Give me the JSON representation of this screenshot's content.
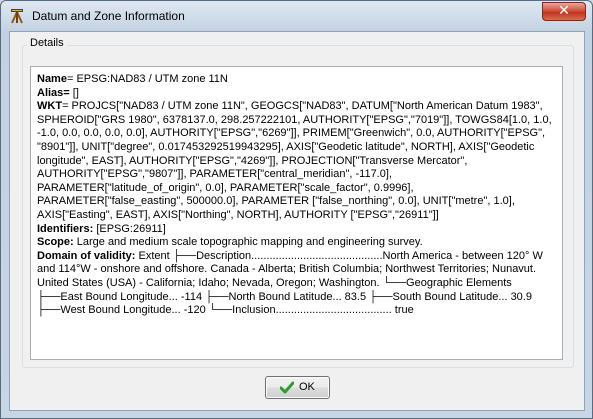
{
  "window": {
    "title": "Datum and Zone Information",
    "close_symbol": "✕",
    "close_icon": "close-icon",
    "app_icon": "tripod-icon"
  },
  "details": {
    "group_label": "Details",
    "name_label": "Name",
    "name_value": "EPSG:NAD83 / UTM zone 11N",
    "alias_label": "Alias",
    "alias_value": "[]",
    "wkt_label": "WKT",
    "wkt_value": "PROJCS[\"NAD83 / UTM zone 11N\", GEOGCS[\"NAD83\", DATUM[\"North American Datum 1983\", SPHEROID[\"GRS 1980\", 6378137.0, 298.257222101, AUTHORITY[\"EPSG\",\"7019\"]], TOWGS84[1.0, 1.0, -1.0, 0.0, 0.0, 0.0, 0.0], AUTHORITY[\"EPSG\",\"6269\"]], PRIMEM[\"Greenwich\", 0.0, AUTHORITY[\"EPSG\", \"8901\"]], UNIT[\"degree\", 0.017453292519943295], AXIS[\"Geodetic latitude\", NORTH], AXIS[\"Geodetic longitude\", EAST], AUTHORITY[\"EPSG\",\"4269\"]], PROJECTION[\"Transverse Mercator\", AUTHORITY[\"EPSG\",\"9807\"]], PARAMETER[\"central_meridian\", -117.0], PARAMETER[\"latitude_of_origin\", 0.0], PARAMETER[\"scale_factor\", 0.9996], PARAMETER[\"false_easting\", 500000.0], PARAMETER [\"false_northing\", 0.0], UNIT[\"metre\", 1.0], AXIS[\"Easting\", EAST], AXIS[\"Northing\", NORTH], AUTHORITY [\"EPSG\",\"26911\"]]",
    "identifiers_label": "Identifiers",
    "identifiers_value": "[EPSG:26911]",
    "scope_label": "Scope",
    "scope_value": "Large and medium scale topographic mapping and engineering survey.",
    "domain_label": "Domain of validity",
    "domain_value": "Extent ├──Description...........................................North America - between 120° W and 114°W - onshore and offshore. Canada - Alberta; British Columbia; Northwest Territories; Nunavut. United States (USA) - California; Idaho; Nevada, Oregon; Washington. └──Geographic Elements ├──East Bound Longitude... -114 ├──North Bound Latitude... 83.5 ├──South Bound Latitude... 30.9 ├──West Bound Longitude... -120 └──Inclusion...................................... true"
  },
  "ok_button": {
    "label": "OK",
    "icon": "checkmark-icon"
  }
}
